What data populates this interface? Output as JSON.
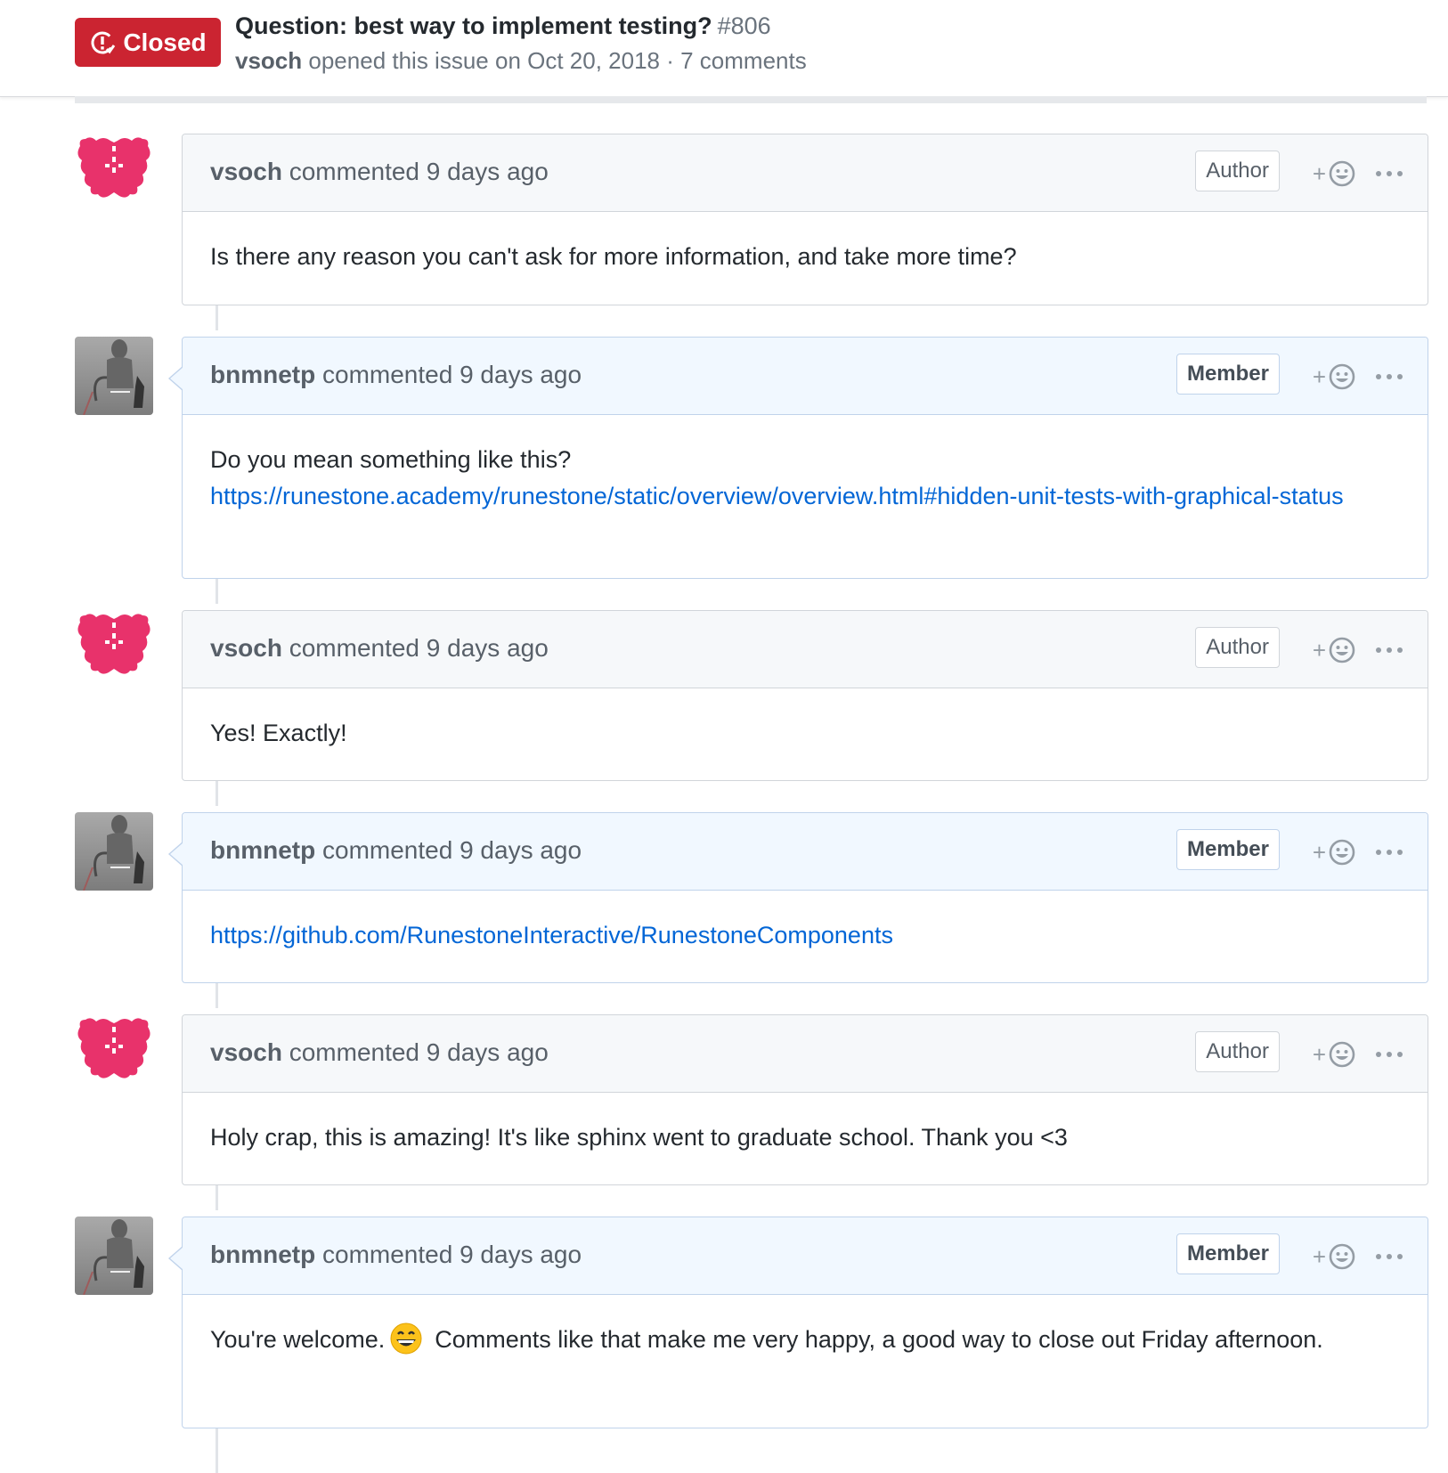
{
  "issue": {
    "state": "Closed",
    "title": "Question: best way to implement testing?",
    "number": "#806",
    "author": "vsoch",
    "meta": "opened this issue on Oct 20, 2018 · 7 comments"
  },
  "comments": [
    {
      "user": "vsoch",
      "action": "commented 9 days ago",
      "role": "Author",
      "body": "Is there any reason you can't ask for more information, and take more time?"
    },
    {
      "user": "bnmnetp",
      "action": "commented 9 days ago",
      "role": "Member",
      "body_text": "Do you mean something like this?",
      "link": "https://runestone.academy/runestone/static/overview/overview.html#hidden-unit-tests-with-graphical-status"
    },
    {
      "user": "vsoch",
      "action": "commented 9 days ago",
      "role": "Author",
      "body": "Yes! Exactly!"
    },
    {
      "user": "bnmnetp",
      "action": "commented 9 days ago",
      "role": "Member",
      "link": "https://github.com/RunestoneInteractive/RunestoneComponents"
    },
    {
      "user": "vsoch",
      "action": "commented 9 days ago",
      "role": "Author",
      "body": "Holy crap, this is amazing! It's like sphinx went to graduate school. Thank you <3"
    },
    {
      "user": "bnmnetp",
      "action": "commented 9 days ago",
      "role": "Member",
      "body_before": "You're welcome.",
      "body_after": "Comments like that make me very happy, a good way to close out Friday afternoon."
    }
  ],
  "reaction_plus": "+",
  "colors": {
    "closed": "#cb2431",
    "link": "#0366d6",
    "author_avatar": "#e8326b"
  },
  "icons": {
    "state": "issue-closed-icon",
    "reaction": "smiley-icon",
    "more": "kebab-horizontal-icon",
    "emoji": "grinning-face-emoji"
  }
}
